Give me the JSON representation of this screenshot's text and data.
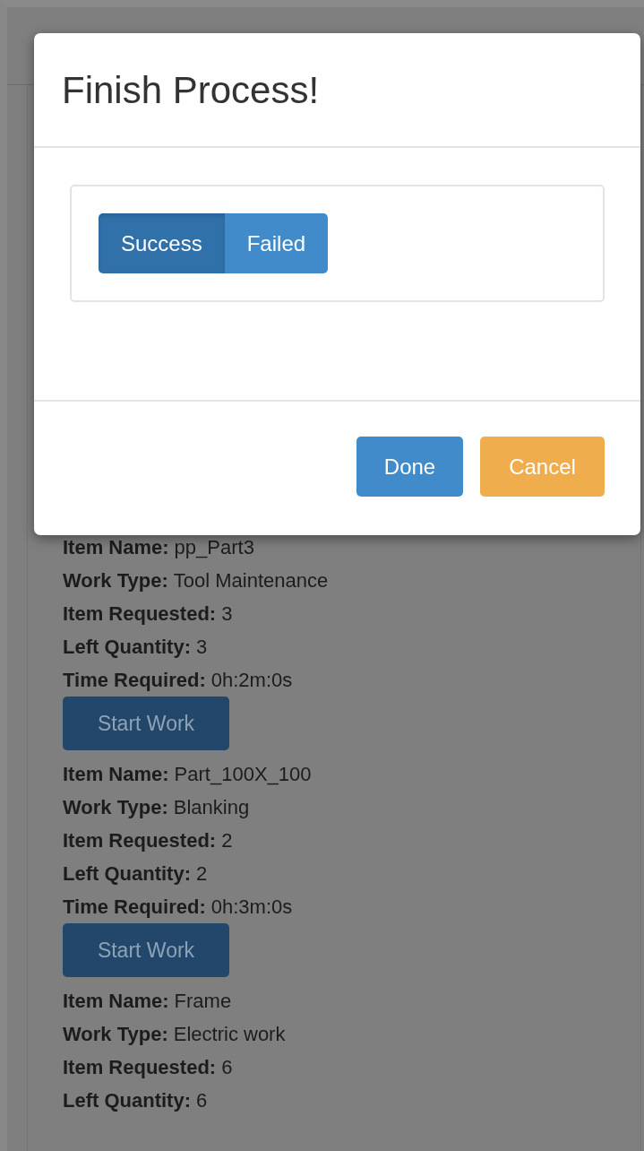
{
  "modal": {
    "title": "Finish Process!",
    "toggle": [
      {
        "label": "Success",
        "selected": true
      },
      {
        "label": "Failed",
        "selected": false
      }
    ],
    "buttons": [
      {
        "label": "Done",
        "kind": "primary"
      },
      {
        "label": "Cancel",
        "kind": "warning"
      }
    ]
  },
  "items": [
    {
      "fields": [
        {
          "label": "Item Name:",
          "value": "pp_Part3"
        },
        {
          "label": "Work Type:",
          "value": "Tool Maintenance"
        },
        {
          "label": "Item Requested:",
          "value": "3"
        },
        {
          "label": "Left Quantity:",
          "value": "3"
        },
        {
          "label": "Time Required:",
          "value": "0h:2m:0s"
        }
      ],
      "button": "Start Work"
    },
    {
      "fields": [
        {
          "label": "Item Name:",
          "value": "Part_100X_100"
        },
        {
          "label": "Work Type:",
          "value": "Blanking"
        },
        {
          "label": "Item Requested:",
          "value": "2"
        },
        {
          "label": "Left Quantity:",
          "value": "2"
        },
        {
          "label": "Time Required:",
          "value": "0h:3m:0s"
        }
      ],
      "button": "Start Work"
    },
    {
      "fields": [
        {
          "label": "Item Name:",
          "value": "Frame"
        },
        {
          "label": "Work Type:",
          "value": "Electric work"
        },
        {
          "label": "Item Requested:",
          "value": "6"
        },
        {
          "label": "Left Quantity:",
          "value": "6"
        }
      ]
    }
  ]
}
